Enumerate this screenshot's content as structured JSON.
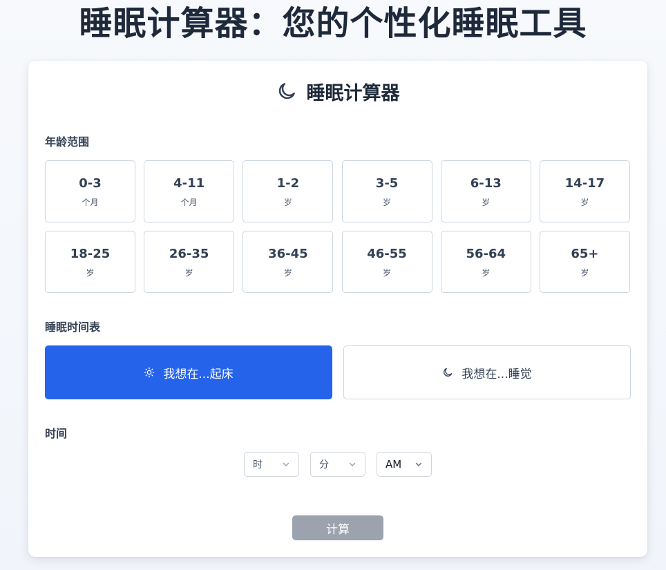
{
  "page": {
    "title": "睡眠计算器：您的个性化睡眠工具"
  },
  "card": {
    "title": "睡眠计算器",
    "icon": "moon-icon"
  },
  "age_section": {
    "label": "年龄范围",
    "options": [
      {
        "range": "0-3",
        "unit": "个月"
      },
      {
        "range": "4-11",
        "unit": "个月"
      },
      {
        "range": "1-2",
        "unit": "岁"
      },
      {
        "range": "3-5",
        "unit": "岁"
      },
      {
        "range": "6-13",
        "unit": "岁"
      },
      {
        "range": "14-17",
        "unit": "岁"
      },
      {
        "range": "18-25",
        "unit": "岁"
      },
      {
        "range": "26-35",
        "unit": "岁"
      },
      {
        "range": "36-45",
        "unit": "岁"
      },
      {
        "range": "46-55",
        "unit": "岁"
      },
      {
        "range": "56-64",
        "unit": "岁"
      },
      {
        "range": "65+",
        "unit": "岁"
      }
    ]
  },
  "schedule_section": {
    "label": "睡眠时间表",
    "wake": {
      "label": "我想在...起床",
      "icon": "sun-icon",
      "selected": true
    },
    "sleep": {
      "label": "我想在...睡觉",
      "icon": "moon-icon",
      "selected": false
    }
  },
  "time_section": {
    "label": "时间",
    "hour": {
      "value": "时"
    },
    "minute": {
      "value": "分"
    },
    "period": {
      "value": "AM"
    }
  },
  "actions": {
    "calculate_label": "计算"
  },
  "colors": {
    "primary": "#2563eb",
    "disabled_button": "#9ca3af",
    "border": "#cbd5e1",
    "heading": "#1e293b"
  }
}
